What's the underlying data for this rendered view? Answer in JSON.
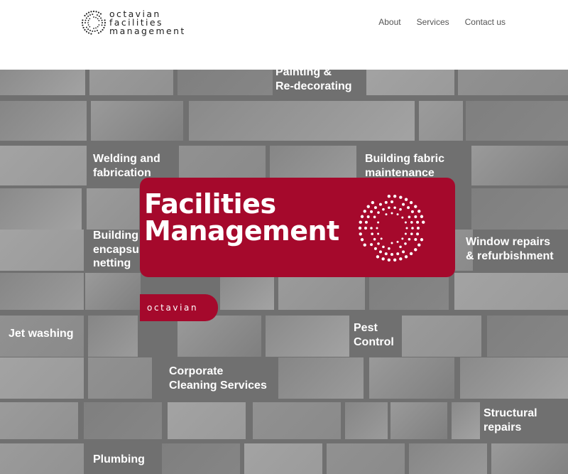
{
  "brand": {
    "line1": "octavian",
    "line2": "facilities",
    "line3": "management",
    "color": "#a5092c"
  },
  "nav": [
    {
      "label": "About"
    },
    {
      "label": "Services"
    },
    {
      "label": "Contact us"
    }
  ],
  "hero": {
    "title_line1": "Facilities",
    "title_line2": "Management",
    "tab_label": "octavian",
    "services": {
      "painting": [
        "Painting &",
        "Re-decorating"
      ],
      "welding": [
        "Welding and",
        "fabrication"
      ],
      "fabric": [
        "Building fabric",
        "maintenance"
      ],
      "netting": [
        "Building",
        "encapsu",
        "netting"
      ],
      "window": [
        "Window repairs",
        "& refurbishment"
      ],
      "jet": [
        "Jet washing"
      ],
      "pest": [
        "Pest",
        "Control"
      ],
      "cleaning": [
        "Corporate",
        "Cleaning Services"
      ],
      "structural": [
        "Structural",
        "repairs"
      ],
      "plumbing": [
        "Plumbing"
      ]
    }
  }
}
